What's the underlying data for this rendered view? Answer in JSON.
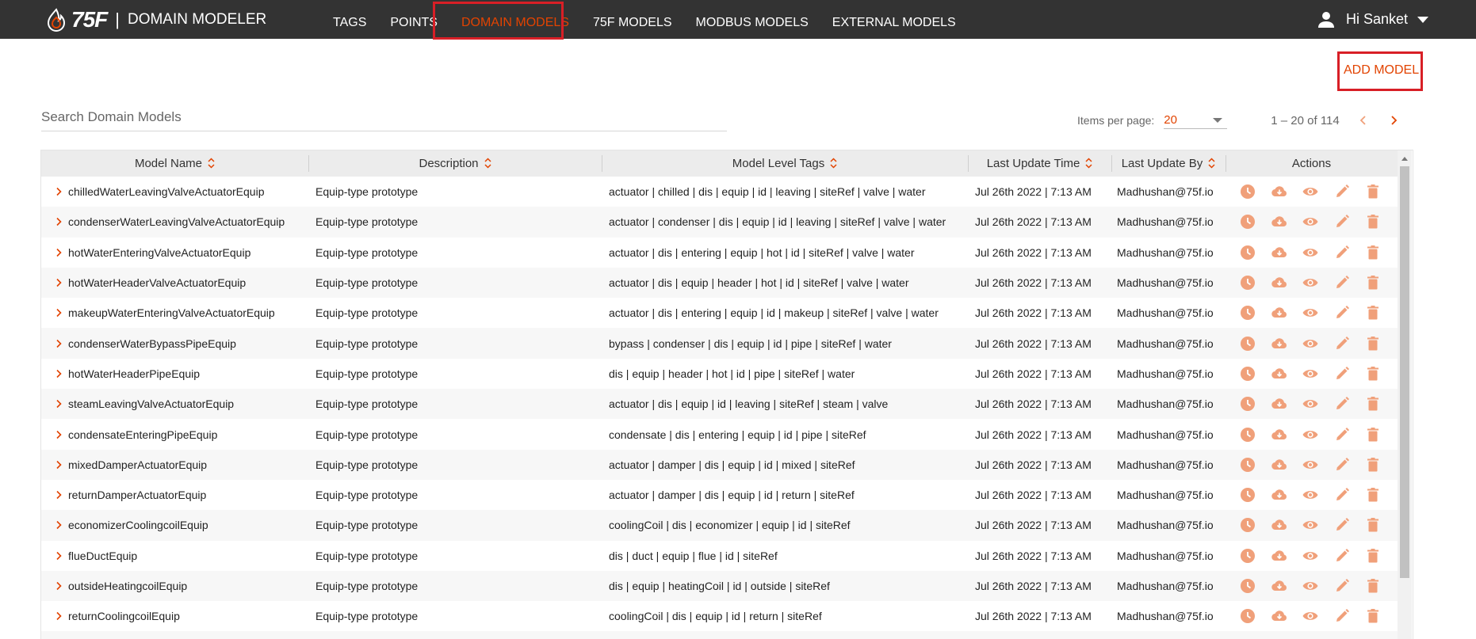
{
  "app": {
    "logo_text": "75F",
    "separator": "|",
    "title": "DOMAIN MODELER"
  },
  "nav": {
    "items": [
      {
        "label": "TAGS",
        "active": false
      },
      {
        "label": "POINTS",
        "active": false
      },
      {
        "label": "DOMAIN MODELS",
        "active": true
      },
      {
        "label": "75F MODELS",
        "active": false
      },
      {
        "label": "MODBUS MODELS",
        "active": false
      },
      {
        "label": "EXTERNAL MODELS",
        "active": false
      }
    ]
  },
  "user": {
    "greeting": "Hi Sanket",
    "icon": "person-icon"
  },
  "toolbar": {
    "add_model_label": "ADD MODEL"
  },
  "search": {
    "placeholder": "Search Domain Models",
    "value": ""
  },
  "paginator": {
    "items_per_page_label": "Items per page:",
    "items_per_page_value": "20",
    "range_label": "1 – 20 of 114"
  },
  "table": {
    "columns": [
      "Model Name",
      "Description",
      "Model Level Tags",
      "Last Update Time",
      "Last Update By",
      "Actions"
    ],
    "action_icons": [
      "history-icon",
      "cloud-download-icon",
      "eye-icon",
      "pencil-icon",
      "trash-icon"
    ],
    "rows": [
      {
        "name": "chilledWaterLeavingValveActuatorEquip",
        "description": "Equip-type prototype",
        "tags": "actuator | chilled | dis | equip | id | leaving | siteRef | valve | water",
        "time": "Jul 26th 2022 | 7:13 AM",
        "by": "Madhushan@75f.io"
      },
      {
        "name": "condenserWaterLeavingValveActuatorEquip",
        "description": "Equip-type prototype",
        "tags": "actuator | condenser | dis | equip | id | leaving | siteRef | valve | water",
        "time": "Jul 26th 2022 | 7:13 AM",
        "by": "Madhushan@75f.io"
      },
      {
        "name": "hotWaterEnteringValveActuatorEquip",
        "description": "Equip-type prototype",
        "tags": "actuator | dis | entering | equip | hot | id | siteRef | valve | water",
        "time": "Jul 26th 2022 | 7:13 AM",
        "by": "Madhushan@75f.io"
      },
      {
        "name": "hotWaterHeaderValveActuatorEquip",
        "description": "Equip-type prototype",
        "tags": "actuator | dis | equip | header | hot | id | siteRef | valve | water",
        "time": "Jul 26th 2022 | 7:13 AM",
        "by": "Madhushan@75f.io"
      },
      {
        "name": "makeupWaterEnteringValveActuatorEquip",
        "description": "Equip-type prototype",
        "tags": "actuator | dis | entering | equip | id | makeup | siteRef | valve | water",
        "time": "Jul 26th 2022 | 7:13 AM",
        "by": "Madhushan@75f.io"
      },
      {
        "name": "condenserWaterBypassPipeEquip",
        "description": "Equip-type prototype",
        "tags": "bypass | condenser | dis | equip | id | pipe | siteRef | water",
        "time": "Jul 26th 2022 | 7:13 AM",
        "by": "Madhushan@75f.io"
      },
      {
        "name": "hotWaterHeaderPipeEquip",
        "description": "Equip-type prototype",
        "tags": "dis | equip | header | hot | id | pipe | siteRef | water",
        "time": "Jul 26th 2022 | 7:13 AM",
        "by": "Madhushan@75f.io"
      },
      {
        "name": "steamLeavingValveActuatorEquip",
        "description": "Equip-type prototype",
        "tags": "actuator | dis | equip | id | leaving | siteRef | steam | valve",
        "time": "Jul 26th 2022 | 7:13 AM",
        "by": "Madhushan@75f.io"
      },
      {
        "name": "condensateEnteringPipeEquip",
        "description": "Equip-type prototype",
        "tags": "condensate | dis | entering | equip | id | pipe | siteRef",
        "time": "Jul 26th 2022 | 7:13 AM",
        "by": "Madhushan@75f.io"
      },
      {
        "name": "mixedDamperActuatorEquip",
        "description": "Equip-type prototype",
        "tags": "actuator | damper | dis | equip | id | mixed | siteRef",
        "time": "Jul 26th 2022 | 7:13 AM",
        "by": "Madhushan@75f.io"
      },
      {
        "name": "returnDamperActuatorEquip",
        "description": "Equip-type prototype",
        "tags": "actuator | damper | dis | equip | id | return | siteRef",
        "time": "Jul 26th 2022 | 7:13 AM",
        "by": "Madhushan@75f.io"
      },
      {
        "name": "economizerCoolingcoilEquip",
        "description": "Equip-type prototype",
        "tags": "coolingCoil | dis | economizer | equip | id | siteRef",
        "time": "Jul 26th 2022 | 7:13 AM",
        "by": "Madhushan@75f.io"
      },
      {
        "name": "flueDuctEquip",
        "description": "Equip-type prototype",
        "tags": "dis | duct | equip | flue | id | siteRef",
        "time": "Jul 26th 2022 | 7:13 AM",
        "by": "Madhushan@75f.io"
      },
      {
        "name": "outsideHeatingcoilEquip",
        "description": "Equip-type prototype",
        "tags": "dis | equip | heatingCoil | id | outside | siteRef",
        "time": "Jul 26th 2022 | 7:13 AM",
        "by": "Madhushan@75f.io"
      },
      {
        "name": "returnCoolingcoilEquip",
        "description": "Equip-type prototype",
        "tags": "coolingCoil | dis | equip | id | return | siteRef",
        "time": "Jul 26th 2022 | 7:13 AM",
        "by": "Madhushan@75f.io"
      },
      {
        "name": "",
        "description": "",
        "tags": "",
        "time": "",
        "by": ""
      }
    ]
  },
  "colors": {
    "accent": "#e24301",
    "topbar": "#333333",
    "icon": "#f0a07a",
    "highlight_box": "#d81f26"
  }
}
